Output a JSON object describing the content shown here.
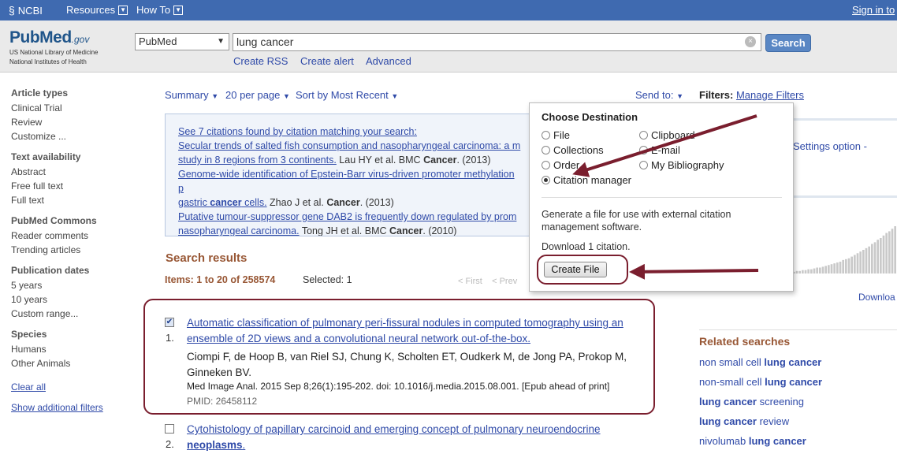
{
  "topbar": {
    "ncbi": "NCBI",
    "resources": "Resources",
    "howto": "How To",
    "signin": "Sign in to"
  },
  "header": {
    "logo_pub": "Pub",
    "logo_med": "Med",
    "logo_gov": ".gov",
    "nlm_line1": "US National Library of Medicine",
    "nlm_line2": "National Institutes of Health",
    "database": "PubMed",
    "query": "lung cancer",
    "search_label": "Search",
    "create_rss": "Create RSS",
    "create_alert": "Create alert",
    "advanced": "Advanced"
  },
  "sidebar": {
    "article_types": {
      "title": "Article types",
      "items": [
        "Clinical Trial",
        "Review",
        "Customize ..."
      ]
    },
    "text_availability": {
      "title": "Text availability",
      "items": [
        "Abstract",
        "Free full text",
        "Full text"
      ]
    },
    "pubmed_commons": {
      "title": "PubMed Commons",
      "items": [
        "Reader comments",
        "Trending articles"
      ]
    },
    "publication_dates": {
      "title": "Publication dates",
      "items": [
        "5 years",
        "10 years",
        "Custom range..."
      ]
    },
    "species": {
      "title": "Species",
      "items": [
        "Humans",
        "Other Animals"
      ]
    },
    "clear_all": "Clear all",
    "show_additional": "Show additional filters"
  },
  "toolbar": {
    "summary": "Summary",
    "per_page": "20 per page",
    "sort": "Sort by Most Recent",
    "send_to": "Send to:",
    "filters_label": "Filters:",
    "manage_filters": "Manage Filters"
  },
  "citations": {
    "header": "See 7 citations found by citation matching your search:",
    "items": [
      {
        "title": "Secular trends of salted fish consumption and nasopharyngeal carcinoma: a m",
        "title2": "study in 8 regions from 3 continents.",
        "source": "Lau HY et al. BMC ",
        "source_bold": "Cancer",
        "year": ". (2013)"
      },
      {
        "title": "Genome-wide identification of Epstein-Barr virus-driven promoter methylation p",
        "title2a": "gastric ",
        "title2b": "cancer",
        "title2c": " cells.",
        "source": "Zhao J et al. ",
        "source_bold": "Cancer",
        "year": ". (2013)"
      },
      {
        "title": "Putative tumour-suppressor gene DAB2 is frequently down regulated by prom",
        "title2": "nasopharyngeal carcinoma.",
        "source": "Tong JH et al. BMC ",
        "source_bold": "Cancer",
        "year": ". (2010)"
      }
    ]
  },
  "results": {
    "title": "Search results",
    "items_count": "Items: 1 to 20 of 258574",
    "selected": "Selected: 1",
    "first": "< First",
    "prev": "< Prev",
    "list": [
      {
        "number": "1.",
        "title": "Automatic classification of pulmonary peri-fissural nodules in computed tomography using an ensemble of 2D views and a convolutional neural network out-of-the-box.",
        "authors": "Ciompi F, de Hoop B, van Riel SJ, Chung K, Scholten ET, Oudkerk M, de Jong PA, Prokop M, Ginneken BV.",
        "journal": "Med Image Anal. 2015 Sep 8;26(1):195-202. doi: 10.1016/j.media.2015.08.001. [Epub ahead of print]",
        "pmid": "PMID: 26458112",
        "checked": true
      },
      {
        "number": "2.",
        "title_a": "Cytohistology of papillary carcinoid and emerging concept of pulmonary neuroendocrine",
        "title_b": "neoplasms",
        "title_c": ".",
        "checked": false
      }
    ]
  },
  "popup": {
    "title": "Choose Destination",
    "options_left": [
      "File",
      "Collections",
      "Order",
      "Citation manager"
    ],
    "options_right": [
      "Clipboard",
      "E-mail",
      "My Bibliography"
    ],
    "selected_option": "Citation manager",
    "description": "Generate a file for use with external citation management software.",
    "download": "Download 1 citation.",
    "create_file": "Create File"
  },
  "right_panel": {
    "settings": "Settings option -",
    "download": "Downloa"
  },
  "related": {
    "title": "Related searches",
    "items": [
      {
        "pre": "non small cell ",
        "bold": "lung cancer",
        "post": ""
      },
      {
        "pre": "non-small cell ",
        "bold": "lung cancer",
        "post": ""
      },
      {
        "pre": "",
        "bold": "lung cancer",
        "post": " screening"
      },
      {
        "pre": "",
        "bold": "lung cancer",
        "post": " review"
      },
      {
        "pre": "nivolumab ",
        "bold": "lung cancer",
        "post": ""
      }
    ]
  },
  "colors": {
    "topbar": "#3f6ab0",
    "link": "#2f4aa8",
    "section_heading": "#985735",
    "annotation": "#7a1e2e"
  },
  "chart_data": {
    "type": "bar",
    "values": [
      2,
      3,
      3,
      4,
      4,
      5,
      5,
      6,
      7,
      7,
      8,
      9,
      10,
      11,
      12,
      13,
      14,
      16,
      17,
      18,
      20,
      22,
      24,
      26,
      28,
      30,
      32,
      35,
      37,
      40,
      42,
      45,
      48,
      50,
      53,
      56
    ]
  }
}
